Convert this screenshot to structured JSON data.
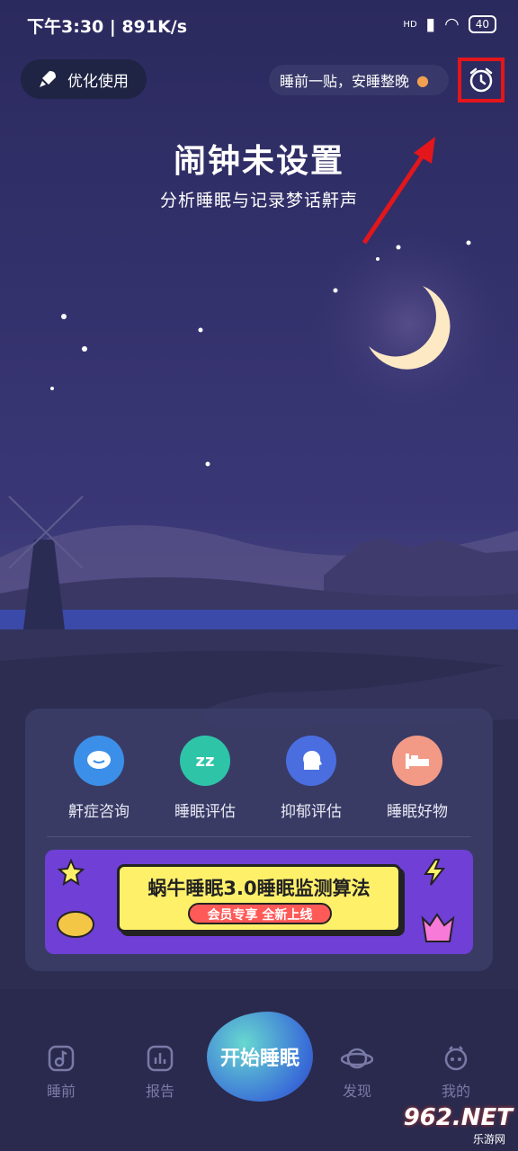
{
  "status_bar": {
    "time": "下午3:30 | 891K/s",
    "network": "HD",
    "battery": "40"
  },
  "header": {
    "optimize_label": "优化使用",
    "tip_text": "睡前一贴，安睡整晚"
  },
  "hero": {
    "title": "闹钟未设置",
    "subtitle": "分析睡眠与记录梦话鼾声"
  },
  "features": [
    {
      "label": "鼾症咨询",
      "color": "#3b8fe8"
    },
    {
      "label": "睡眠评估",
      "color": "#2ec4a8"
    },
    {
      "label": "抑郁评估",
      "color": "#4a6ee0"
    },
    {
      "label": "睡眠好物",
      "color": "#f29a86"
    }
  ],
  "promo": {
    "title": "蜗牛睡眠3.0睡眠监测算法",
    "tag": "会员专享 全新上线"
  },
  "bottom_nav": {
    "items": [
      {
        "label": "睡前",
        "icon": "music-note-icon"
      },
      {
        "label": "报告",
        "icon": "bar-chart-icon"
      },
      {
        "label": "发现",
        "icon": "planet-icon"
      },
      {
        "label": "我的",
        "icon": "profile-icon"
      }
    ],
    "start_label": "开始睡眠"
  },
  "watermark": {
    "brand": "962.NET",
    "sub": "乐游网"
  },
  "colors": {
    "sky_top": "#2a2a5c",
    "alarm_highlight": "#e3161b"
  }
}
